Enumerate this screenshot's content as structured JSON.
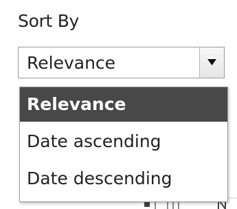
{
  "sort": {
    "label": "Sort By",
    "selected": "Relevance",
    "options": [
      "Relevance",
      "Date ascending",
      "Date descending"
    ]
  },
  "colors": {
    "highlight": "#484848",
    "text": "#222222",
    "border": "#9a9a9a"
  },
  "icons": {
    "dropdown": "triangle-down-icon"
  }
}
